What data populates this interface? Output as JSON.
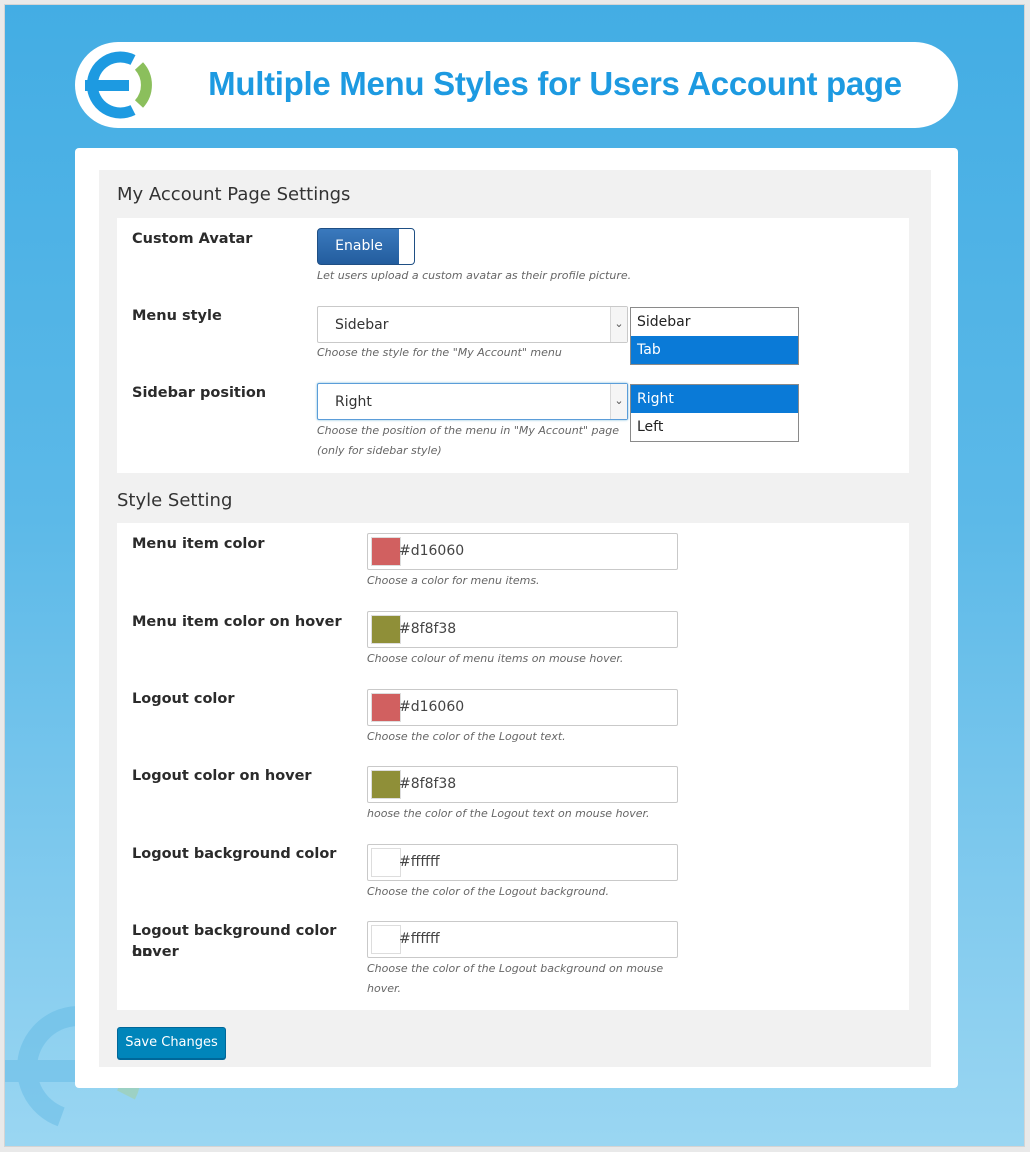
{
  "header": {
    "title": "Multiple Menu Styles for Users Account page"
  },
  "colors": {
    "accent": "#1d9ae1",
    "background_top": "#43ade4",
    "logo_blue": "#1d9ae1",
    "logo_green": "#8bbf5c",
    "primary_button": "#0085ba",
    "toggle": "#2a65a6",
    "option_selected": "#0a7ad7"
  },
  "account_section": {
    "title": "My Account Page Settings",
    "custom_avatar": {
      "label": "Custom Avatar",
      "toggle_label": "Enable",
      "toggle_state": "enabled",
      "description": "Let users upload a custom avatar as their profile picture."
    },
    "menu_style": {
      "label": "Menu style",
      "value": "Sidebar",
      "description": "Choose the style for the \"My Account\" menu",
      "options": [
        "Sidebar",
        "Tab"
      ],
      "highlighted_option": "Tab"
    },
    "sidebar_position": {
      "label": "Sidebar position",
      "value": "Right",
      "description_line1": "Choose the position of the menu in \"My Account\" page",
      "description_line2": "(only for sidebar style)",
      "options": [
        "Right",
        "Left"
      ],
      "highlighted_option": "Right"
    }
  },
  "style_section": {
    "title": "Style Setting",
    "fields": [
      {
        "label": "Menu item color",
        "value": "#d16060",
        "description": "Choose a color for menu items."
      },
      {
        "label": "Menu item color on hover",
        "value": "#8f8f38",
        "description": "Choose colour of menu items on mouse hover."
      },
      {
        "label": "Logout color",
        "value": "#d16060",
        "description": "Choose the color of the Logout text."
      },
      {
        "label": "Logout color on hover",
        "value": "#8f8f38",
        "description": "hoose the color of the Logout text on mouse hover."
      },
      {
        "label": "Logout background color",
        "value": "#ffffff",
        "description": "Choose the color of the Logout background."
      },
      {
        "label_line1": "Logout background color on",
        "label_line2": "hover",
        "value": "#ffffff",
        "description_line1": "Choose the color of the Logout background on mouse",
        "description_line2": "hover."
      }
    ]
  },
  "save_button": {
    "label": "Save Changes"
  }
}
